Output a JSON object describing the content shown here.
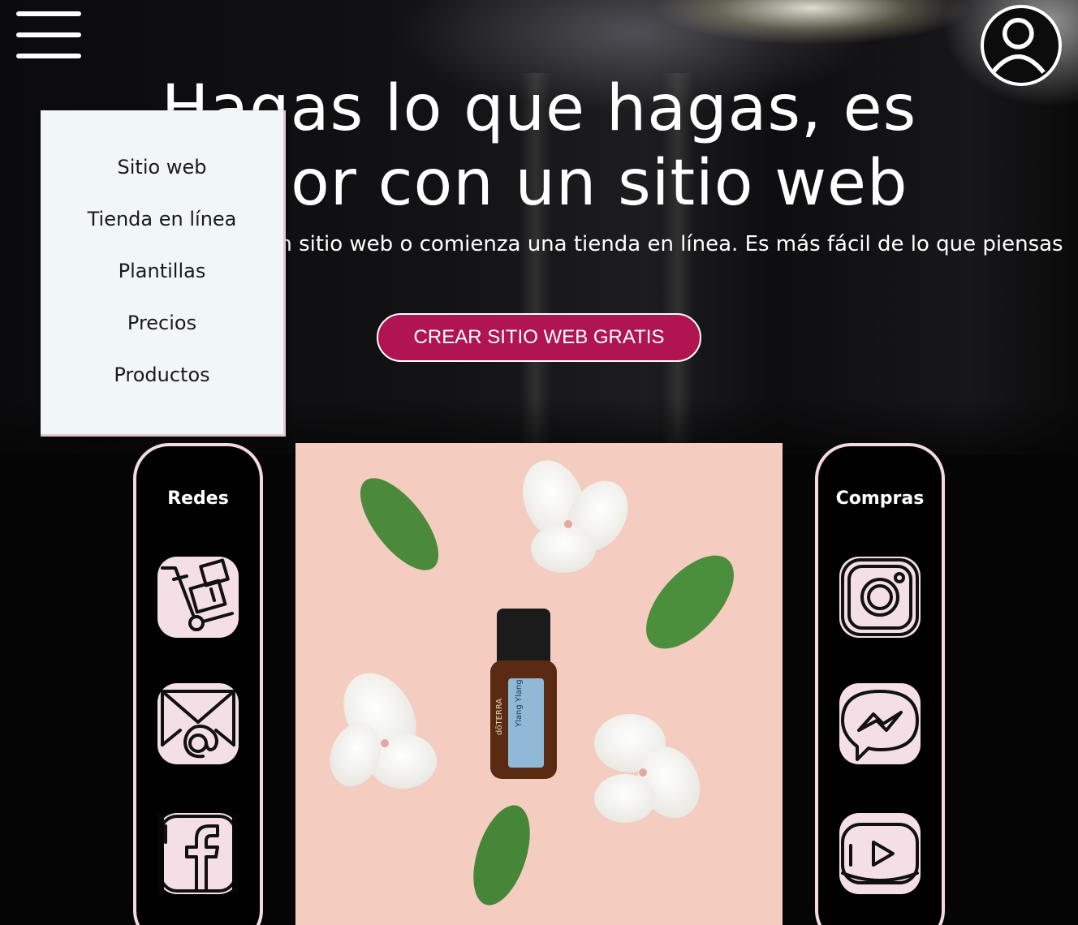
{
  "header": {
    "menu_icon": "hamburger-icon",
    "account_icon": "user-account-icon"
  },
  "hero": {
    "headline_line1": "Hagas lo que hagas, es",
    "headline_line2": "mejor con un sitio web",
    "subtitle": "Crea un sitio web o comienza una tienda en línea. Es más fácil de lo que piensas",
    "cta_label": "CREAR SITIO WEB GRATIS",
    "cta_color": "#b01451"
  },
  "menu": {
    "items": [
      "Sitio web",
      "Tienda en línea",
      "Plantillas",
      "Precios",
      "Productos"
    ]
  },
  "left_panel": {
    "title": "Redes",
    "icons": [
      "hand-truck-icon",
      "email-icon",
      "facebook-icon"
    ]
  },
  "right_panel": {
    "title": "Compras",
    "icons": [
      "instagram-icon",
      "messenger-icon",
      "youtube-icon"
    ]
  },
  "product_image": {
    "icon": "essential-oil-bottle-image",
    "bottle_brand": "dōTERRA",
    "bottle_name": "Ylang Ylang"
  },
  "colors": {
    "panel_border": "#f3d9e2",
    "tile_bg": "#f4dfe7",
    "photo_bg": "#f4cdc0"
  }
}
